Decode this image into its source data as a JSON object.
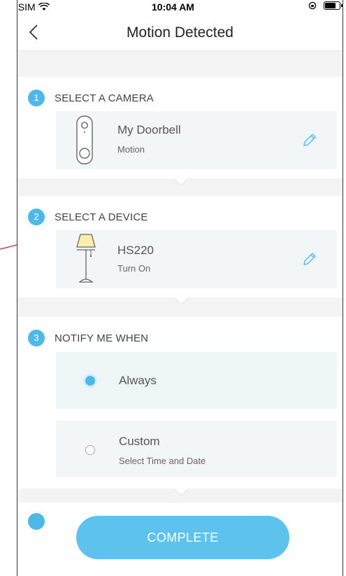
{
  "status_bar": {
    "carrier": "No SIM",
    "time": "10:04 AM"
  },
  "nav": {
    "title": "Motion Detected"
  },
  "steps": [
    {
      "number": "1",
      "title": "SELECT A CAMERA",
      "card": {
        "name": "My Doorbell",
        "detail": "Motion"
      }
    },
    {
      "number": "2",
      "title": "SELECT A DEVICE",
      "card": {
        "name": "HS220",
        "detail": "Turn On"
      }
    },
    {
      "number": "3",
      "title": "NOTIFY ME WHEN",
      "options": [
        {
          "label": "Always",
          "selected": true
        },
        {
          "label": "Custom",
          "sublabel": "Select Time and Date",
          "selected": false
        }
      ]
    }
  ],
  "complete_button": {
    "label": "COMPLETE"
  },
  "colors": {
    "accent": "#4fb8ea",
    "button": "#5ec3ec",
    "annotation": "#b3204a"
  },
  "icons": [
    "wifi-icon",
    "orientation-lock-icon",
    "battery-icon",
    "back-chevron-icon",
    "doorbell-camera-icon",
    "edit-pencil-icon",
    "floor-lamp-icon"
  ]
}
